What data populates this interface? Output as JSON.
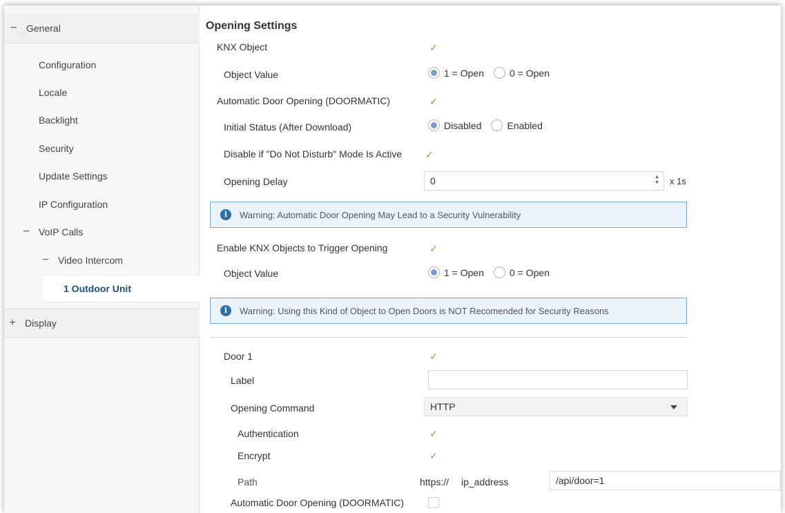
{
  "sidebar": {
    "general": {
      "toggle": "−",
      "label": "General"
    },
    "items": [
      "Configuration",
      "Locale",
      "Backlight",
      "Security",
      "Update Settings",
      "IP Configuration"
    ],
    "voip": {
      "toggle": "−",
      "label": "VoIP Calls"
    },
    "video_intercom": {
      "toggle": "−",
      "label": "Video Intercom"
    },
    "outdoor_unit": "1 Outdoor Unit",
    "display": {
      "toggle": "+",
      "label": "Display"
    }
  },
  "main": {
    "title": "Opening Settings",
    "knx_object": {
      "label": "KNX Object",
      "checked": true
    },
    "object_value_1": {
      "label": "Object Value",
      "options": [
        "1 = Open",
        "0 = Open"
      ],
      "selected": 0
    },
    "doormatic": {
      "label": "Automatic Door Opening (DOORMATIC)",
      "checked": true
    },
    "initial_status": {
      "label": "Initial Status (After Download)",
      "options": [
        "Disabled",
        "Enabled"
      ],
      "selected": 0
    },
    "dnd": {
      "label": "Disable if \"Do Not Disturb\" Mode Is Active",
      "checked": true
    },
    "opening_delay": {
      "label": "Opening Delay",
      "value": "0",
      "unit": "x 1s"
    },
    "warning_1": "Warning: Automatic Door Opening May Lead to a Security Vulnerability",
    "enable_knx": {
      "label": "Enable KNX Objects to Trigger Opening",
      "checked": true
    },
    "object_value_2": {
      "label": "Object Value",
      "options": [
        "1 = Open",
        "0 = Open"
      ],
      "selected": 0
    },
    "warning_2": "Warning: Using this Kind of Object to Open Doors is NOT Recomended for Security Reasons",
    "door1": {
      "label": "Door 1",
      "checked": true
    },
    "door_label": {
      "label": "Label",
      "value": ""
    },
    "opening_command": {
      "label": "Opening Command",
      "value": "HTTP"
    },
    "authentication": {
      "label": "Authentication",
      "checked": true
    },
    "encrypt": {
      "label": "Encrypt",
      "checked": true
    },
    "path": {
      "label": "Path",
      "prefix": "https://",
      "host": "ip_address",
      "value": "/api/door=1"
    },
    "door_doormatic": {
      "label": "Automatic Door Opening (DOORMATIC)",
      "checked": false
    }
  },
  "icons": {
    "check": "checkmark-icon",
    "info": "info-icon",
    "dropdown": "chevron-down-icon"
  }
}
